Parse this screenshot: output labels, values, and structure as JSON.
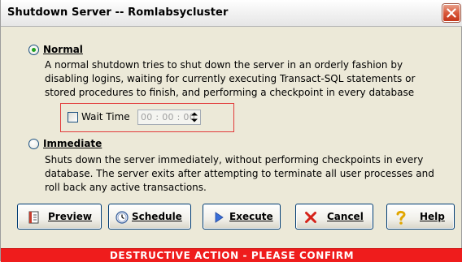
{
  "window": {
    "title": "Shutdown Server -- Romlabsycluster"
  },
  "normal": {
    "label": "Normal",
    "selected": true,
    "description": [
      "A normal shutdown tries to shut down the server in an orderly fashion by",
      "disabling logins,  waiting for currently executing Transact-SQL statements or",
      "stored procedures to finish, and performing a checkpoint in every database"
    ]
  },
  "wait_time": {
    "label": "Wait Time",
    "checked": false,
    "value": "00 : 00 : 00"
  },
  "immediate": {
    "label": "Immediate",
    "selected": false,
    "description": [
      "Shuts down the server immediately, without performing checkpoints in every",
      "database. The server exits after attempting to terminate all user processes and",
      "roll back any active transactions."
    ]
  },
  "buttons": {
    "preview": "Preview",
    "schedule": "Schedule",
    "execute": "Execute",
    "cancel": "Cancel",
    "help": "Help"
  },
  "banner": {
    "text": "DESTRUCTIVE ACTION - PLEASE CONFIRM",
    "color": "#ef1c1c"
  },
  "icons": {
    "close": "close-icon",
    "preview": "document-preview-icon",
    "schedule": "clock-icon",
    "execute": "play-arrow-icon",
    "cancel": "x-icon",
    "help": "question-mark-icon"
  }
}
